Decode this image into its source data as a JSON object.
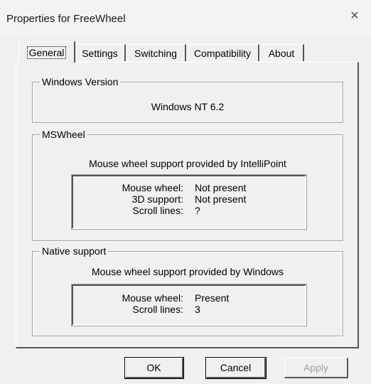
{
  "window": {
    "title": "Properties for FreeWheel",
    "close_glyph": "✕"
  },
  "tabs": [
    {
      "label": "General",
      "active": true
    },
    {
      "label": "Settings",
      "active": false
    },
    {
      "label": "Switching",
      "active": false
    },
    {
      "label": "Compatibility",
      "active": false
    },
    {
      "label": "About",
      "active": false
    }
  ],
  "windows_version": {
    "title": "Windows Version",
    "value": "Windows NT 6.2"
  },
  "mswheel": {
    "title": "MSWheel",
    "support_text": "Mouse wheel support provided by IntelliPoint",
    "rows": [
      {
        "label": "Mouse wheel:",
        "value": "Not present"
      },
      {
        "label": "3D support:",
        "value": "Not present"
      },
      {
        "label": "Scroll lines:",
        "value": "?"
      }
    ]
  },
  "native": {
    "title": "Native support",
    "support_text": "Mouse wheel support provided by Windows",
    "rows": [
      {
        "label": "Mouse wheel:",
        "value": "Present"
      },
      {
        "label": "Scroll lines:",
        "value": "3"
      }
    ]
  },
  "buttons": {
    "ok": "OK",
    "cancel": "Cancel",
    "apply": "Apply"
  }
}
